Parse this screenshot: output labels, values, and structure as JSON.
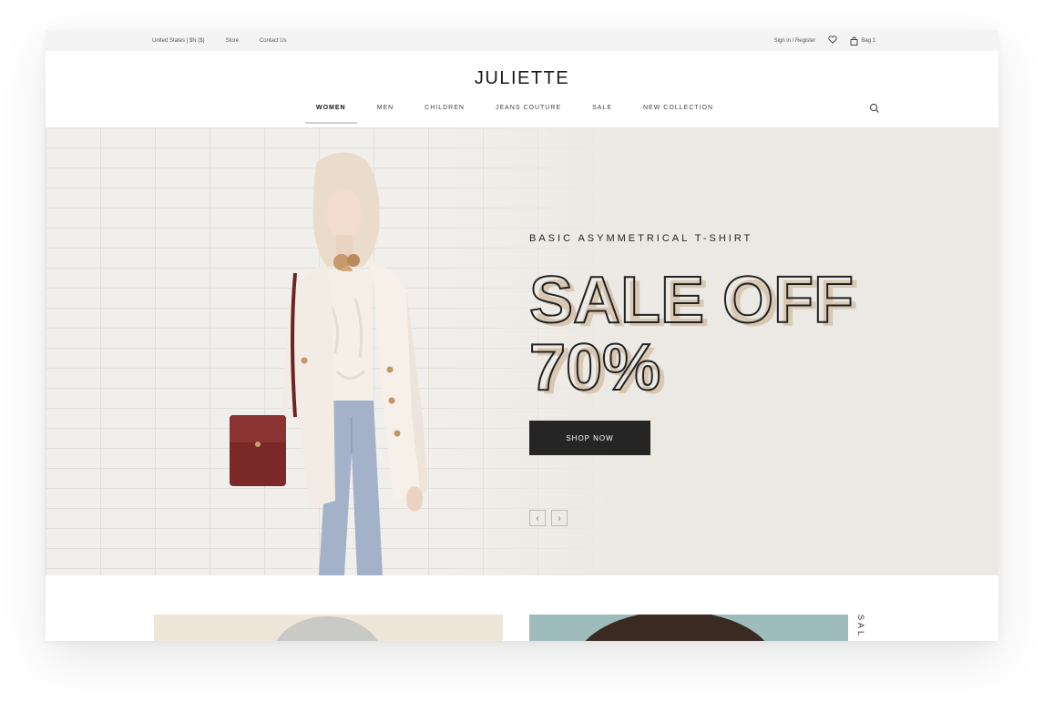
{
  "topbar": {
    "region": "United States | $N ($)",
    "store": "Store",
    "contact": "Contact Us",
    "signin": "Sign in / Register",
    "bag": "Bag 1"
  },
  "header": {
    "logo": "JULIETTE",
    "nav": [
      "WOMEN",
      "MEN",
      "CHILDREN",
      "JEANS COUTURE",
      "SALE",
      "NEW COLLECTION"
    ],
    "active_nav": "WOMEN"
  },
  "hero": {
    "subtitle": "BASIC ASYMMETRICAL T-SHIRT",
    "headline_line1": "SALE OFF",
    "headline_line2": "70%",
    "cta": "SHOP NOW",
    "prev": "‹",
    "next": "›"
  },
  "lower": {
    "side_label": "SAL"
  },
  "colors": {
    "hero_bg": "#ece9e4",
    "button_bg": "#252525",
    "headline_fill": "#d8c7b3",
    "headline_stroke": "#222222"
  },
  "icons": [
    "heart-icon",
    "bag-icon",
    "search-icon",
    "chevron-left-icon",
    "chevron-right-icon"
  ]
}
